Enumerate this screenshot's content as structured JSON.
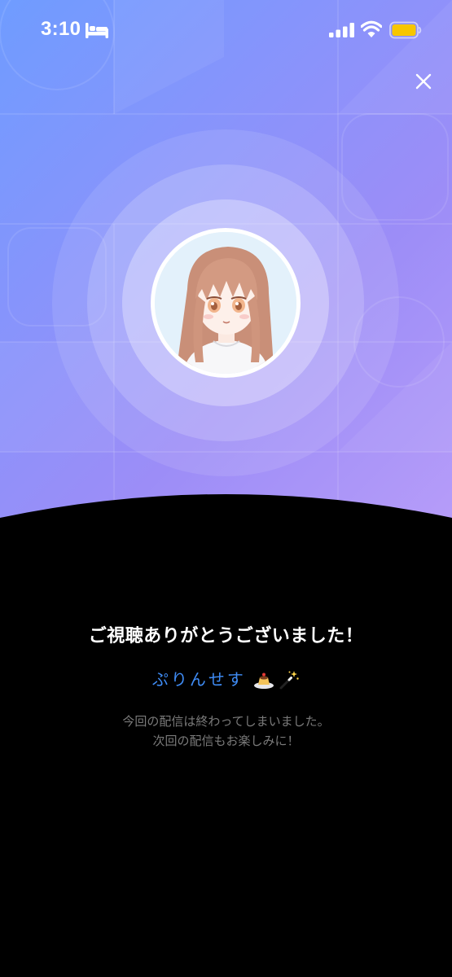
{
  "status_bar": {
    "time": "3:10",
    "icons": [
      "bed-icon",
      "signal-icon",
      "wifi-icon",
      "battery-icon"
    ],
    "battery_color": "#f7c600"
  },
  "header": {
    "close_icon": "close-icon"
  },
  "hero": {
    "gradient_colors": [
      "#6f9cff",
      "#8a93fb",
      "#b69cf9"
    ],
    "avatar_icon": "streamer-avatar"
  },
  "end_screen": {
    "title": "ご視聴ありがとうございました！",
    "streamer_name": "ぷりんせす",
    "name_emojis": [
      "pudding-icon",
      "magic-wand-icon"
    ],
    "name_color": "#3f8cf5",
    "message_line1": "今回の配信は終わってしまいました。",
    "message_line2": "次回の配信もお楽しみに！"
  }
}
